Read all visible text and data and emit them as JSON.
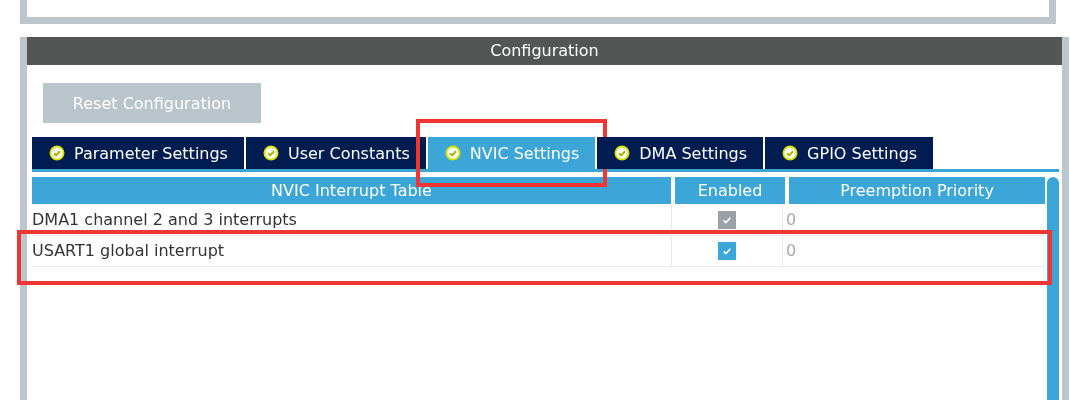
{
  "panel_title": "Configuration",
  "reset_button": {
    "label": "Reset Configuration",
    "disabled": true
  },
  "tabs": [
    {
      "label": "Parameter Settings",
      "selected": false,
      "highlighted": false
    },
    {
      "label": "User Constants",
      "selected": false,
      "highlighted": false
    },
    {
      "label": "NVIC Settings",
      "selected": true,
      "highlighted": true
    },
    {
      "label": "DMA Settings",
      "selected": false,
      "highlighted": false
    },
    {
      "label": "GPIO Settings",
      "selected": false,
      "highlighted": false
    }
  ],
  "table": {
    "columns": [
      "NVIC Interrupt Table",
      "Enabled",
      "Preemption Priority"
    ],
    "rows": [
      {
        "name": "DMA1 channel 2 and 3 interrupts",
        "enabled": true,
        "disabled": true,
        "priority": "0",
        "highlighted": false
      },
      {
        "name": "USART1 global interrupt",
        "enabled": true,
        "disabled": false,
        "priority": "0",
        "highlighted": true
      }
    ]
  }
}
